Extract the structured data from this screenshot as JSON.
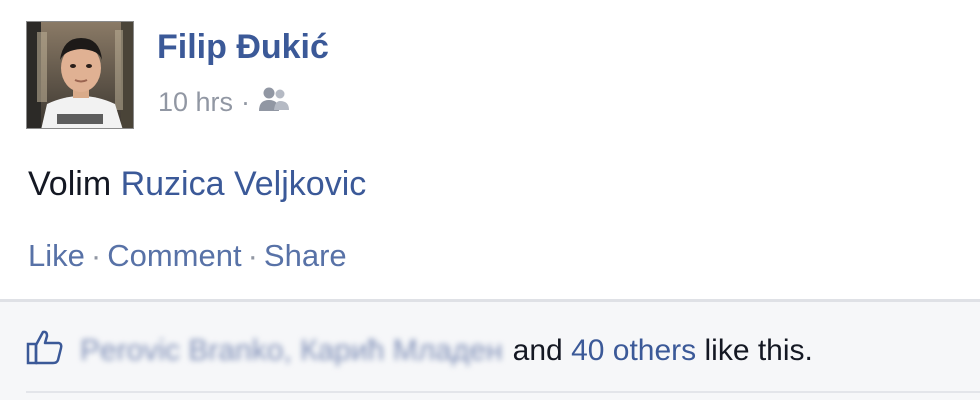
{
  "post": {
    "author": "Filip Đukić",
    "timestamp": "10 hrs",
    "meta_separator": "·",
    "audience_icon": "friends-icon",
    "text_prefix": "Volim ",
    "text_tag": "Ruzica Veljkovic"
  },
  "actions": {
    "like": "Like",
    "comment": "Comment",
    "share": "Share",
    "separator": "·"
  },
  "likes": {
    "icon": "thumbs-up-icon",
    "names": "Perovic Branko, Карић Младен",
    "and_text": "and",
    "others_link": "40 others",
    "suffix": "like this."
  },
  "colors": {
    "link": "#3b5998",
    "secondary": "#9197a3",
    "panel_bg": "#f6f7f9"
  }
}
